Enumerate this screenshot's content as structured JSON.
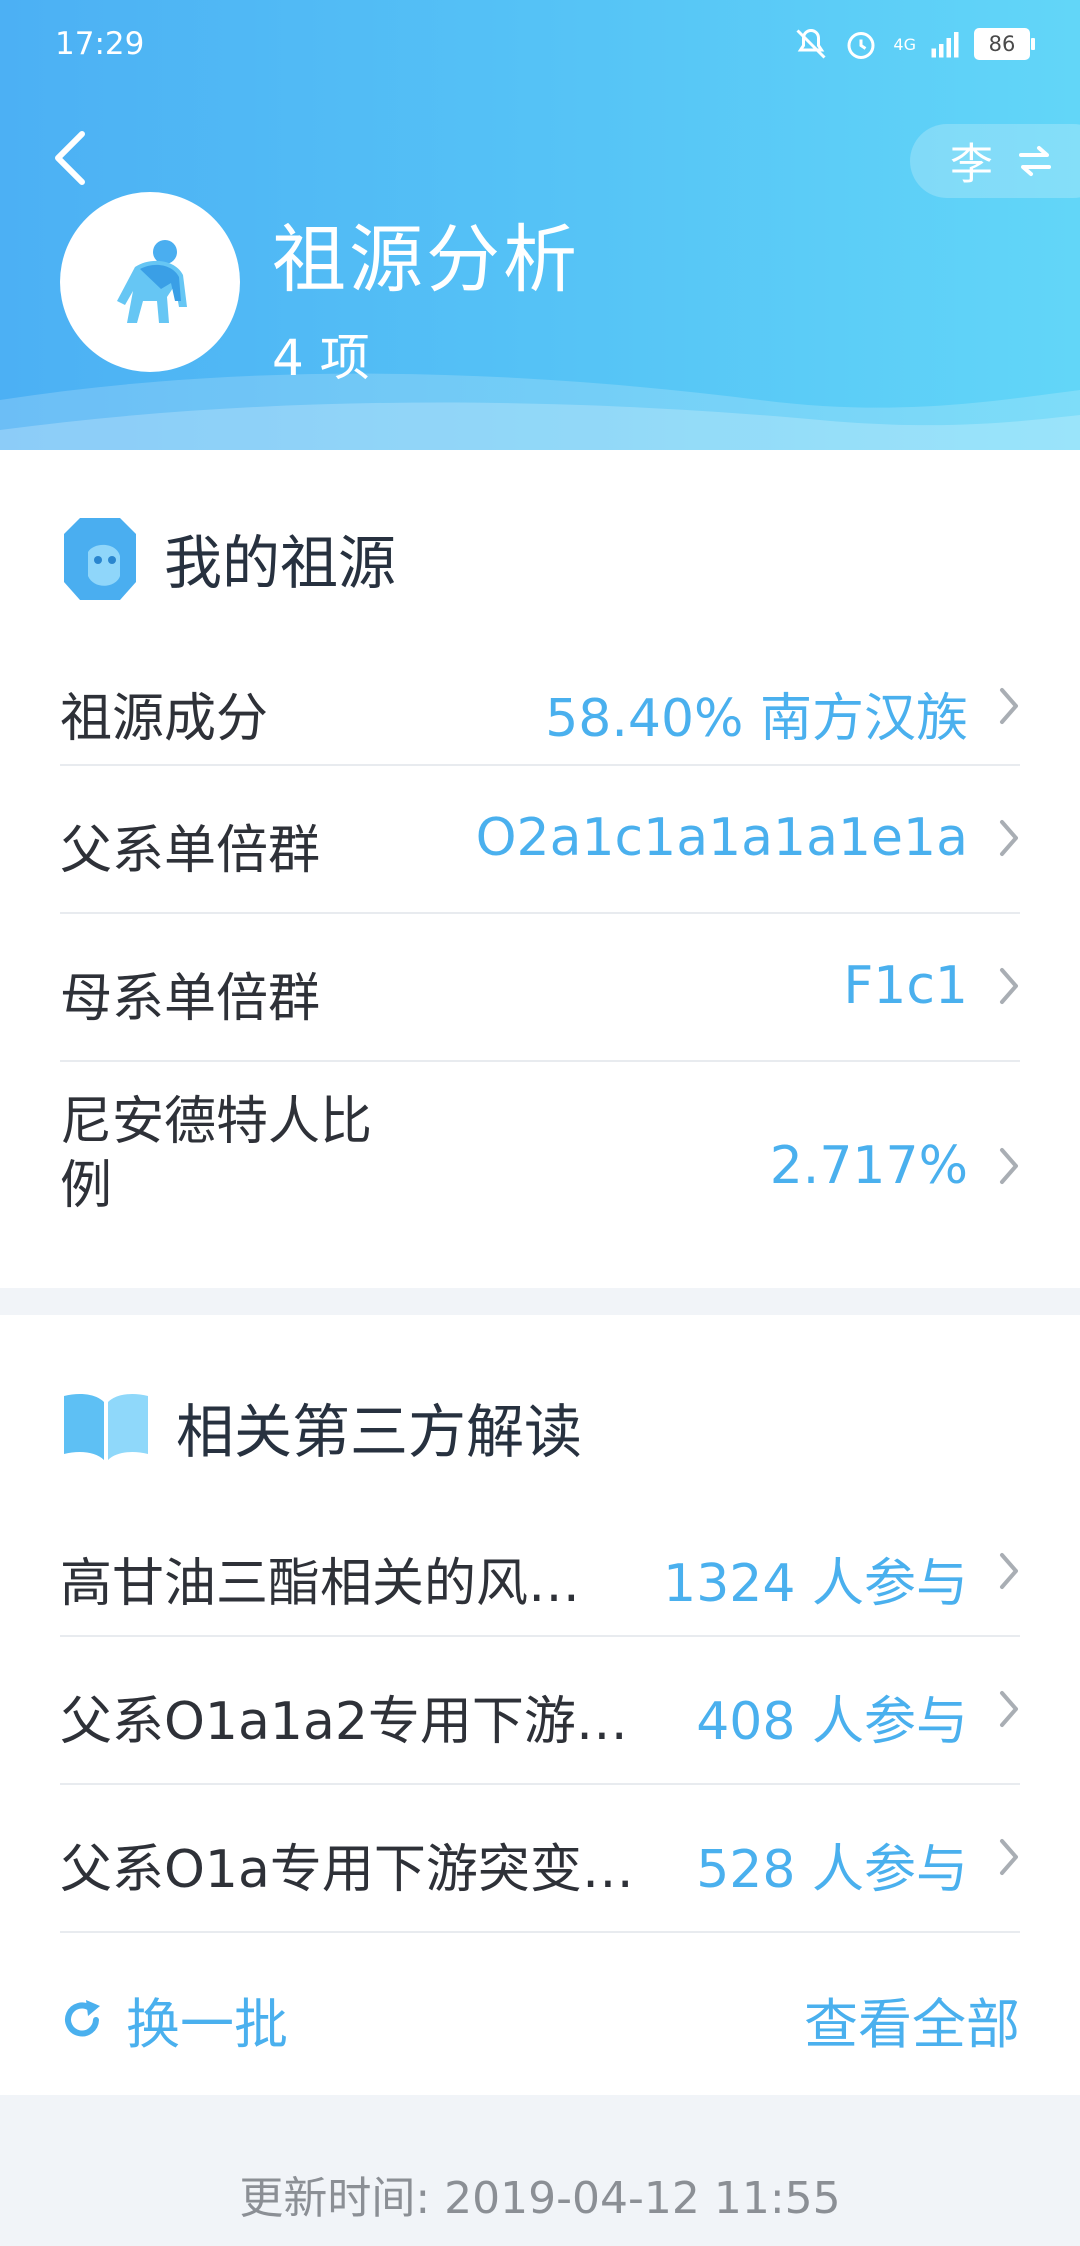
{
  "status_bar": {
    "time": "17:29",
    "network": "4G",
    "battery": "86"
  },
  "header": {
    "title": "祖源分析",
    "count": "4 项",
    "switch_label": "李"
  },
  "my_ancestry": {
    "title": "我的祖源",
    "rows": [
      {
        "label": "祖源成分",
        "value": "58.40% 南方汉族"
      },
      {
        "label": "父系单倍群",
        "value": "O2a1c1a1a1a1e1a"
      },
      {
        "label": "母系单倍群",
        "value": "F1c1"
      },
      {
        "label": "尼安德特人比例",
        "value": "2.717%"
      }
    ]
  },
  "third_party": {
    "title": "相关第三方解读",
    "rows": [
      {
        "label": "高甘油三酯相关的风…",
        "value": "1324 人参与"
      },
      {
        "label": "父系O1a1a2专用下游…",
        "value": "408 人参与"
      },
      {
        "label": "父系O1a专用下游突变…",
        "value": "528 人参与"
      }
    ],
    "refresh_label": "换一批",
    "view_all_label": "查看全部"
  },
  "footer": {
    "update_time": "更新时间: 2019-04-12 11:55"
  },
  "colors": {
    "accent": "#4ab0ee",
    "header_start": "#4cb0f4",
    "header_end": "#62d6f8"
  }
}
